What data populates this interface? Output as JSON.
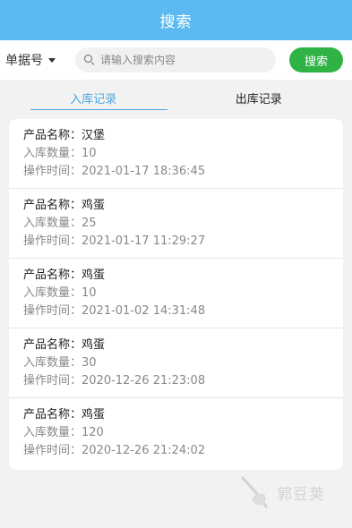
{
  "header": {
    "title": "搜索"
  },
  "search": {
    "filter_label": "单据号",
    "placeholder": "请输入搜索内容",
    "value": "",
    "button_label": "搜索"
  },
  "tabs": [
    {
      "label": "入库记录",
      "active": true
    },
    {
      "label": "出库记录",
      "active": false
    }
  ],
  "labels": {
    "product_name": "产品名称：",
    "quantity": "入库数量：",
    "time": "操作时间："
  },
  "records": [
    {
      "product_name": "汉堡",
      "quantity": "10",
      "time": "2021-01-17 18:36:45"
    },
    {
      "product_name": "鸡蛋",
      "quantity": "25",
      "time": "2021-01-17 11:29:27"
    },
    {
      "product_name": "鸡蛋",
      "quantity": "10",
      "time": "2021-01-02 14:31:48"
    },
    {
      "product_name": "鸡蛋",
      "quantity": "30",
      "time": "2020-12-26 21:23:08"
    },
    {
      "product_name": "鸡蛋",
      "quantity": "120",
      "time": "2020-12-26 21:24:02"
    }
  ],
  "watermark": {
    "text": "郭豆荚"
  },
  "colors": {
    "header_bg": "#5cbaf0",
    "accent": "#4aa8e0",
    "search_button": "#2fb344"
  }
}
